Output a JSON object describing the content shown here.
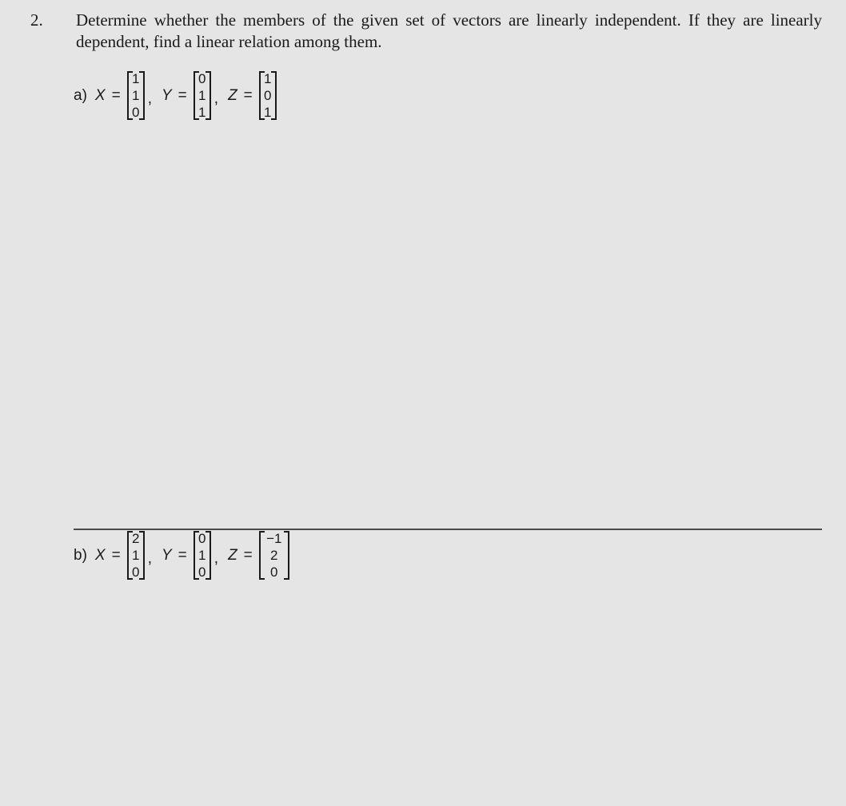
{
  "problem": {
    "number": "2.",
    "text": "Determine whether the members of the given set of vectors are linearly independent. If they are linearly dependent, find a linear relation among them."
  },
  "parts": [
    {
      "label": "a)",
      "vectors": [
        {
          "name": "X",
          "equals": "=",
          "entries": [
            "1",
            "1",
            "0"
          ],
          "separator": ","
        },
        {
          "name": "Y",
          "equals": "=",
          "entries": [
            "0",
            "1",
            "1"
          ],
          "separator": ","
        },
        {
          "name": "Z",
          "equals": "=",
          "entries": [
            "1",
            "0",
            "1"
          ],
          "separator": ""
        }
      ]
    },
    {
      "label": "b)",
      "vectors": [
        {
          "name": "X",
          "equals": "=",
          "entries": [
            "2",
            "1",
            "0"
          ],
          "separator": ","
        },
        {
          "name": "Y",
          "equals": "=",
          "entries": [
            "0",
            "1",
            "0"
          ],
          "separator": ","
        },
        {
          "name": "Z",
          "equals": "=",
          "entries": [
            "−1",
            "2",
            "0"
          ],
          "separator": ""
        }
      ]
    }
  ],
  "colors": {
    "background": "#e5e5e5",
    "text": "#1a1a1a",
    "divider": "#4a4a4a"
  }
}
